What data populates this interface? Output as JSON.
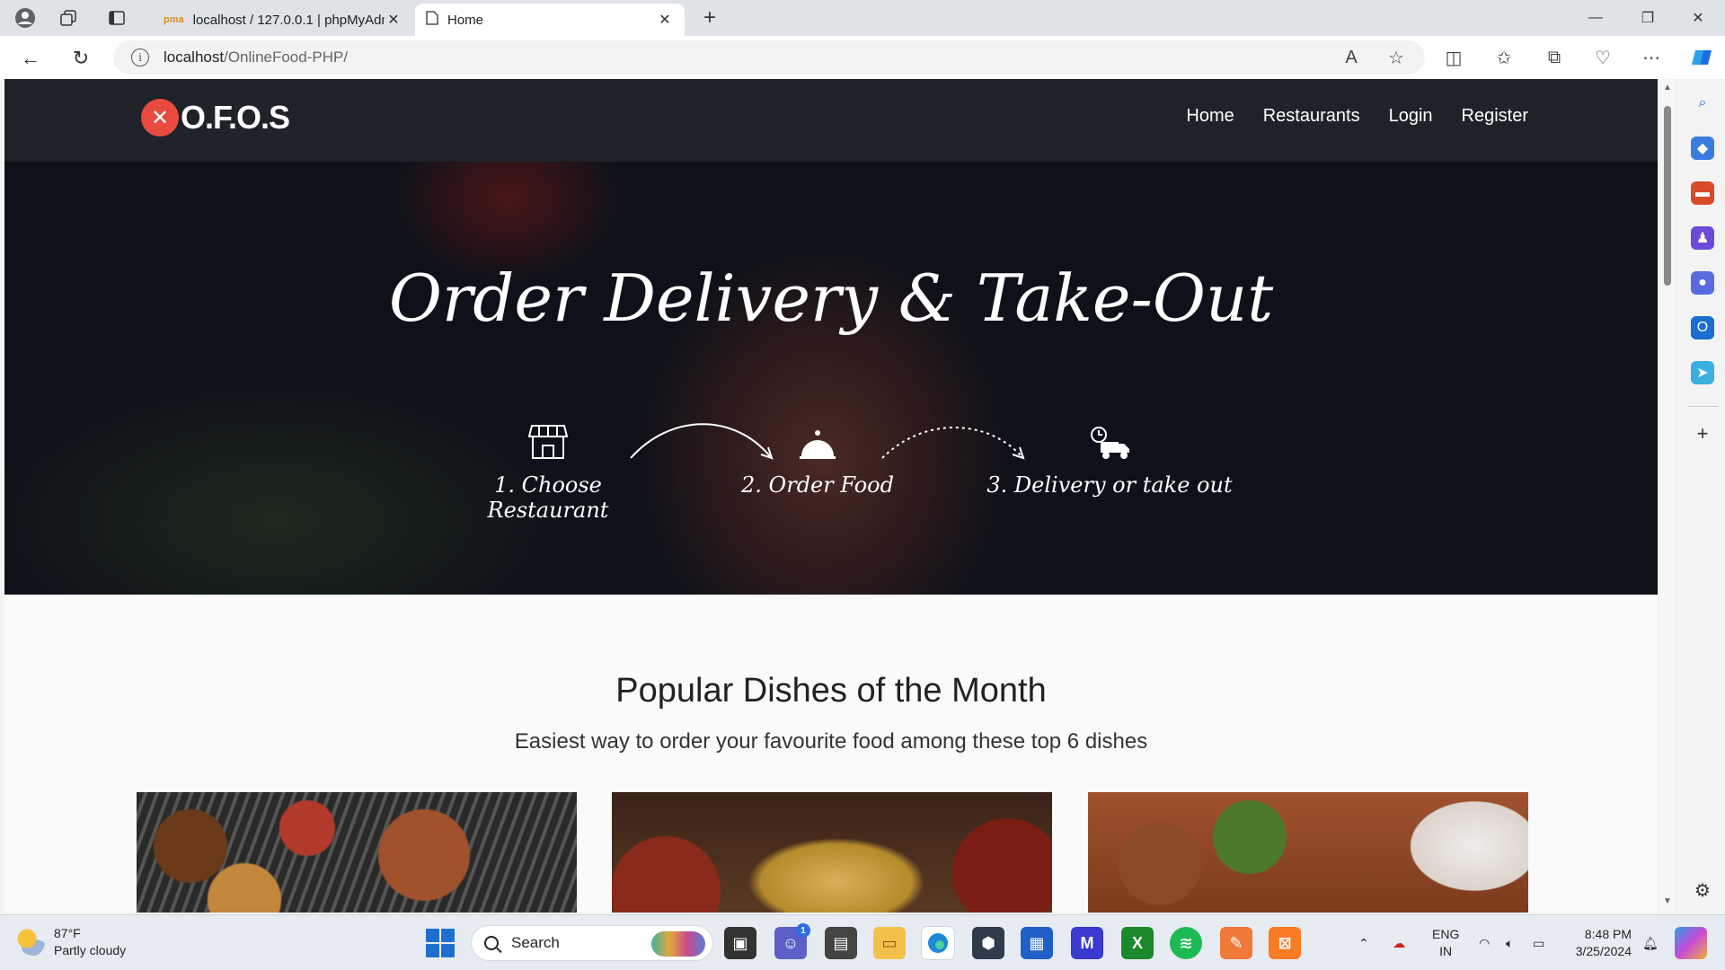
{
  "browser": {
    "tabs": [
      {
        "title": "localhost / 127.0.0.1 | phpMyAdm",
        "favicon": "phpmyadmin-icon",
        "active": false
      },
      {
        "title": "Home",
        "favicon": "page-icon",
        "active": true
      }
    ],
    "address": {
      "host": "localhost",
      "path": "/OnlineFood-PHP/"
    }
  },
  "site": {
    "logo_text": "O.F.O.S",
    "nav": [
      "Home",
      "Restaurants",
      "Login",
      "Register"
    ],
    "hero": {
      "title": "Order Delivery & Take-Out",
      "steps": [
        {
          "label": "1. Choose Restaurant",
          "icon": "storefront-icon"
        },
        {
          "label": "2. Order Food",
          "icon": "cloche-icon"
        },
        {
          "label": "3. Delivery or take out",
          "icon": "delivery-truck-icon"
        }
      ]
    },
    "popular": {
      "title": "Popular Dishes of the Month",
      "subtitle": "Easiest way to order your favourite food among these top 6 dishes"
    }
  },
  "taskbar": {
    "weather": {
      "temp": "87°F",
      "desc": "Partly cloudy"
    },
    "search_placeholder": "Search",
    "chat_badge": "1",
    "lang": {
      "line1": "ENG",
      "line2": "IN"
    },
    "clock": {
      "time": "8:48 PM",
      "date": "3/25/2024"
    }
  },
  "colors": {
    "header_bg": "#1f2329",
    "logo_accent": "#e84a3f",
    "hero_bg": "#0e1119"
  }
}
